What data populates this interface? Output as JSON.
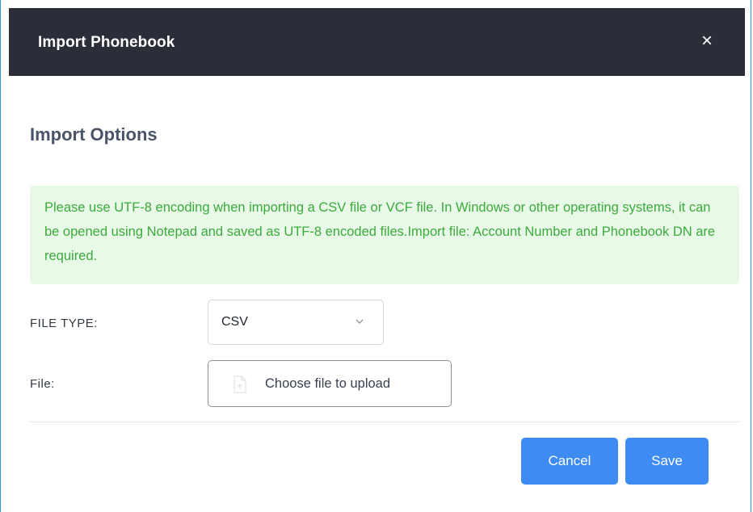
{
  "dialog": {
    "title": "Import Phonebook",
    "close_label": "×"
  },
  "section": {
    "title": "Import Options"
  },
  "notice": {
    "text": "Please use UTF-8 encoding when importing a CSV file or VCF file. In Windows or other operating systems, it can be opened using Notepad and saved as UTF-8 encoded files.Import file: Account Number and Phonebook DN are required."
  },
  "form": {
    "file_type_label": "FILE TYPE:",
    "file_type_value": "CSV",
    "file_label": "File:",
    "upload_label": "Choose file to upload"
  },
  "buttons": {
    "cancel_label": "Cancel",
    "save_label": "Save"
  },
  "colors": {
    "header_bg": "#2b2e38",
    "primary": "#3d8bf3",
    "notice_bg": "#e8f9e8",
    "notice_text": "#3daa3d"
  },
  "icons": {
    "close": "close-icon",
    "dropdown": "chevron-down-icon",
    "upload": "file-upload-icon"
  }
}
